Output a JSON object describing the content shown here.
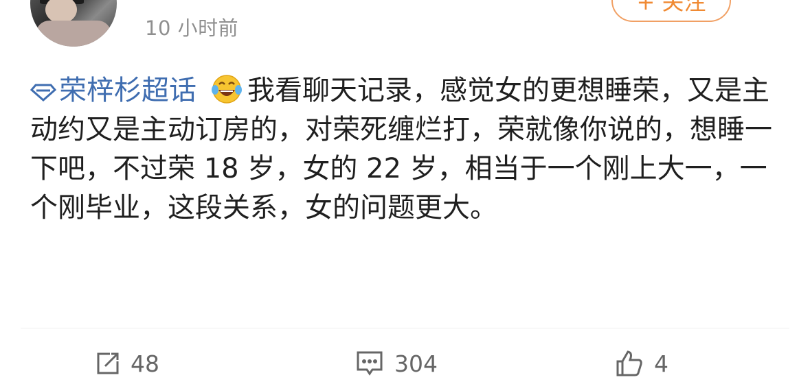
{
  "post_header": {
    "time_ago": "10 小时前",
    "follow_label": "+ 关注"
  },
  "post_body": {
    "topic": "荣梓杉超话",
    "emoji_icon": "laughing-with-tears-icon",
    "text": "我看聊天记录，感觉女的更想睡荣，又是主动约又是主动订房的，对荣死缠烂打，荣就像你说的，想睡一下吧，不过荣 18 岁，女的 22 岁，相当于一个刚上大一，一个刚毕业，这段关系，女的问题更大。"
  },
  "actions": {
    "repost_count": "48",
    "comment_count": "304",
    "like_count": "4"
  },
  "colors": {
    "topic": "#3f6db0",
    "follow_accent": "#f08a33",
    "muted": "#8f8f8f"
  }
}
